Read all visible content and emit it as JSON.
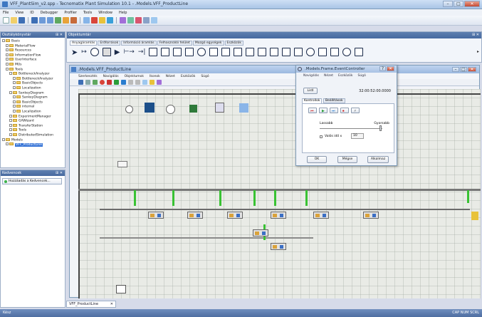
{
  "window": {
    "title": "VFF_PlantSim_v2.spp - Tecnomatix Plant Simulation 10.1 - .Models.VFF_ProductLine"
  },
  "menu": [
    "File",
    "View",
    "ID",
    "Debugger",
    "Profiler",
    "Tools",
    "Window",
    "Help"
  ],
  "class_library": {
    "header": "Osztálykönyvtár",
    "items": [
      {
        "label": "Basis",
        "level": 0
      },
      {
        "label": "MaterialFlow",
        "level": 1
      },
      {
        "label": "Resources",
        "level": 1
      },
      {
        "label": "InformationFlow",
        "level": 1
      },
      {
        "label": "UserInterface",
        "level": 1
      },
      {
        "label": "MUs",
        "level": 1
      },
      {
        "label": "Tools",
        "level": 1
      },
      {
        "label": "BottleneckAnalyzer",
        "level": 2
      },
      {
        "label": "BottleneckAnalyzer",
        "level": 3
      },
      {
        "label": "BasicObjects",
        "level": 3
      },
      {
        "label": "Localization",
        "level": 3
      },
      {
        "label": "SankeyDiagram",
        "level": 2
      },
      {
        "label": "SankeyDiagram",
        "level": 3
      },
      {
        "label": "BasicObjects",
        "level": 3
      },
      {
        "label": "internal",
        "level": 3
      },
      {
        "label": "Localization",
        "level": 3
      },
      {
        "label": "ExperimentManager",
        "level": 2
      },
      {
        "label": "GAWizard",
        "level": 2
      },
      {
        "label": "TransferStation",
        "level": 2
      },
      {
        "label": "Tools",
        "level": 2
      },
      {
        "label": "DistributedSimulation",
        "level": 2
      },
      {
        "label": "Models",
        "level": 0
      },
      {
        "label": "VFF_ProductLine",
        "level": 1,
        "selected": true
      }
    ]
  },
  "favorites": {
    "header": "Kedvencek",
    "add_button": "Hozzáadás a Kedvencek..."
  },
  "object_panel": {
    "header": "Objektumtár",
    "tabs": [
      "Anyagáramlás",
      "Erőforrások",
      "Információ áramlás",
      "Felhasználói felület",
      "Mozgó egységek",
      "Eszközök"
    ]
  },
  "model_window": {
    "title": ".Models.VFF_ProductLine",
    "menu": [
      "Szerkesztés",
      "Navigálás",
      "Objektumok",
      "Ikonok",
      "Nézet",
      "Eszközök",
      "Súgó"
    ]
  },
  "event_controller": {
    "title": ".Models.Frame.EventController",
    "menu": [
      "Navigálás",
      "Nézet",
      "Eszközök",
      "Súgó"
    ],
    "list_button": "Listl",
    "time": "32:00:52:00.0000",
    "tabs": [
      "Kontrollok",
      "Beállítások"
    ],
    "slow_label": "Lassabb",
    "fast_label": "Gyorsabb",
    "realtime_label": "Valós idő x",
    "realtime_value": "10",
    "ok_button": "OK",
    "cancel_button": "Mégse",
    "apply_button": "Alkalmaz"
  },
  "doc_tab": "VFF_ProductLine",
  "status": {
    "left": "Kész",
    "right": "CAP NUM SCRL"
  }
}
